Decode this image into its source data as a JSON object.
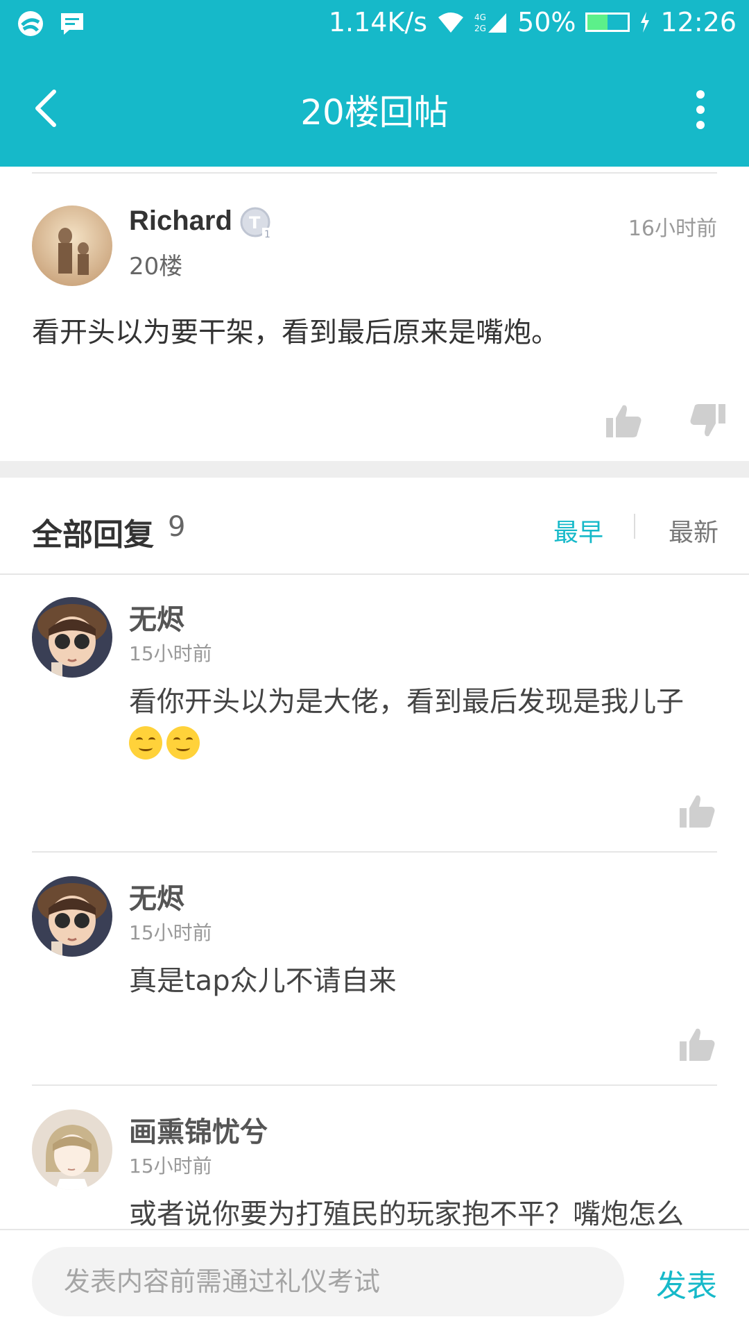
{
  "status": {
    "speed": "1.14K/s",
    "network": "4G 2G",
    "battery": "50%",
    "battery_level": 0.5,
    "time": "12:26"
  },
  "appbar": {
    "title": "20楼回帖"
  },
  "post": {
    "author": "Richard",
    "badge": "T1",
    "floor": "20楼",
    "time": "16小时前",
    "content": "看开头以为要干架，看到最后原来是嘴炮。"
  },
  "replies_header": {
    "title": "全部回复",
    "count": "9",
    "sort_earliest": "最早",
    "sort_newest": "最新"
  },
  "replies": [
    {
      "name": "无烬",
      "time": "15小时前",
      "text": "看你开头以为是大佬，看到最后发现是我儿子"
    },
    {
      "name": "无烬",
      "time": "15小时前",
      "text": "真是tap众儿不请自来"
    },
    {
      "name": "画熏锦忧兮",
      "time": "15小时前",
      "text": "或者说你要为打殖民的玩家抱不平？嘴炮怎么"
    }
  ],
  "composer": {
    "placeholder": "发表内容前需通过礼仪考试",
    "send_label": "发表"
  },
  "colors": {
    "accent": "#16b9c9"
  }
}
